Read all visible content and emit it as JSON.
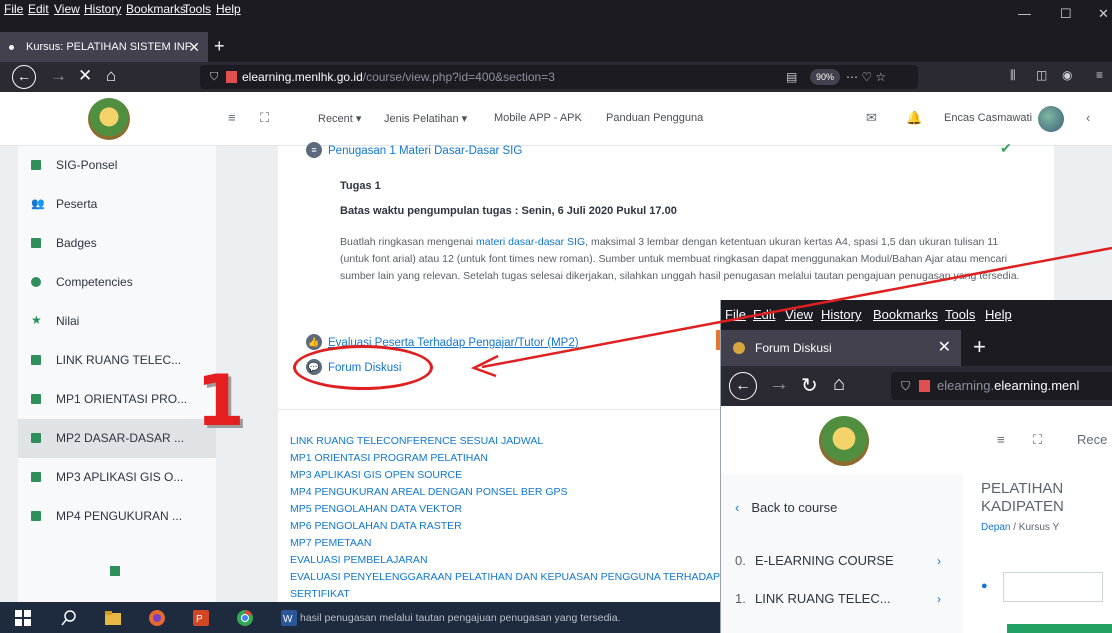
{
  "window1": {
    "menu": [
      "File",
      "Edit",
      "View",
      "History",
      "Bookmarks",
      "Tools",
      "Help"
    ],
    "window_controls": {
      "minimize": "—",
      "maximize": "☐",
      "close": "✕"
    },
    "tab": {
      "title": "Kursus: PELATIHAN SISTEM INF",
      "close": "✕",
      "new_tab": "+"
    },
    "address": {
      "domain": "elearning.menlhk.go.id",
      "path": "/course/view.php?id=400&section=3",
      "zoom": "90%"
    },
    "navbar": {
      "items": [
        "Recent ▾",
        "Jenis Pelatihan ▾",
        "Mobile APP - APK",
        "Panduan Pengguna"
      ],
      "user": "Encas Casmawati"
    },
    "sidebar": {
      "items": [
        {
          "label": "SIG-Ponsel",
          "icon": "folder-icon"
        },
        {
          "label": "Peserta",
          "icon": "users-icon"
        },
        {
          "label": "Badges",
          "icon": "badge-icon"
        },
        {
          "label": "Competencies",
          "icon": "check-circle-icon"
        },
        {
          "label": "Nilai",
          "icon": "star-icon"
        },
        {
          "label": "LINK RUANG TELEC...",
          "icon": "folder-icon"
        },
        {
          "label": "MP1 ORIENTASI PRO...",
          "icon": "folder-icon"
        },
        {
          "label": "MP2 DASAR-DASAR ...",
          "icon": "folder-icon",
          "active": true
        },
        {
          "label": "MP3 APLIKASI GIS O...",
          "icon": "folder-icon"
        },
        {
          "label": "MP4 PENGUKURAN ...",
          "icon": "folder-icon"
        }
      ]
    },
    "content": {
      "assignment_link": "Penugasan 1 Materi Dasar-Dasar SIG",
      "task_title": "Tugas 1",
      "deadline": "Batas waktu pengumpulan tugas : Senin, 6 Juli 2020 Pukul 17.00",
      "desc_before": "Buatlah ringkasan mengenai ",
      "desc_link": "materi dasar-dasar SIG",
      "desc_after": ", maksimal 3 lembar dengan ketentuan ukuran kertas A4, spasi 1,5 dan ukuran tulisan 11 (untuk font arial) atau 12 (untuk font times new roman). Sumber untuk membuat ringkasan dapat menggunakan Modul/Bahan Ajar atau mencari sumber lain yang relevan. Setelah tugas selesai dikerjakan, silahkan unggah hasil penugasan melalui tautan pengajuan penugasan yang tersedia.",
      "eval_link": "Evaluasi Peserta Terhadap Pengajar/Tutor (MP2)",
      "forum_link": "Forum Diskusi",
      "sections": [
        "LINK RUANG TELECONFERENCE SESUAI JADWAL",
        "MP1 ORIENTASI PROGRAM PELATIHAN",
        "MP3 APLIKASI GIS OPEN SOURCE",
        "MP4 PENGUKURAN AREAL DENGAN PONSEL BER GPS",
        "MP5 PENGOLAHAN DATA VEKTOR",
        "MP6 PENGOLAHAN DATA RASTER",
        "MP7 PEMETAAN",
        "EVALUASI PEMBELAJARAN",
        "EVALUASI PENYELENGGARAAN PELATIHAN DAN KEPUASAN PENGGUNA TERHADAP",
        "SERTIFIKAT"
      ]
    }
  },
  "annotation": {
    "step_number": "1",
    "color": "#e02020"
  },
  "taskbar": {
    "caption": "hasil penugasan melalui tautan pengajuan penugasan yang tersedia."
  },
  "window2": {
    "menu": [
      "File",
      "Edit",
      "View",
      "History",
      "Bookmarks",
      "Tools",
      "Help"
    ],
    "tab": {
      "title": "Forum Diskusi",
      "close": "✕",
      "new_tab": "+"
    },
    "address": {
      "domain": "elearning.menl"
    },
    "navbar_item": "Rece",
    "back_to_course": "Back to course",
    "sections": [
      {
        "num": "0.",
        "label": "E-LEARNING COURSE"
      },
      {
        "num": "1.",
        "label": "LINK RUANG TELEC..."
      }
    ],
    "course_title_1": "PELATIHAN",
    "course_title_2": "KADIPATEN",
    "breadcrumb_home": "Depan",
    "breadcrumb_rest": " / Kursus Y"
  }
}
